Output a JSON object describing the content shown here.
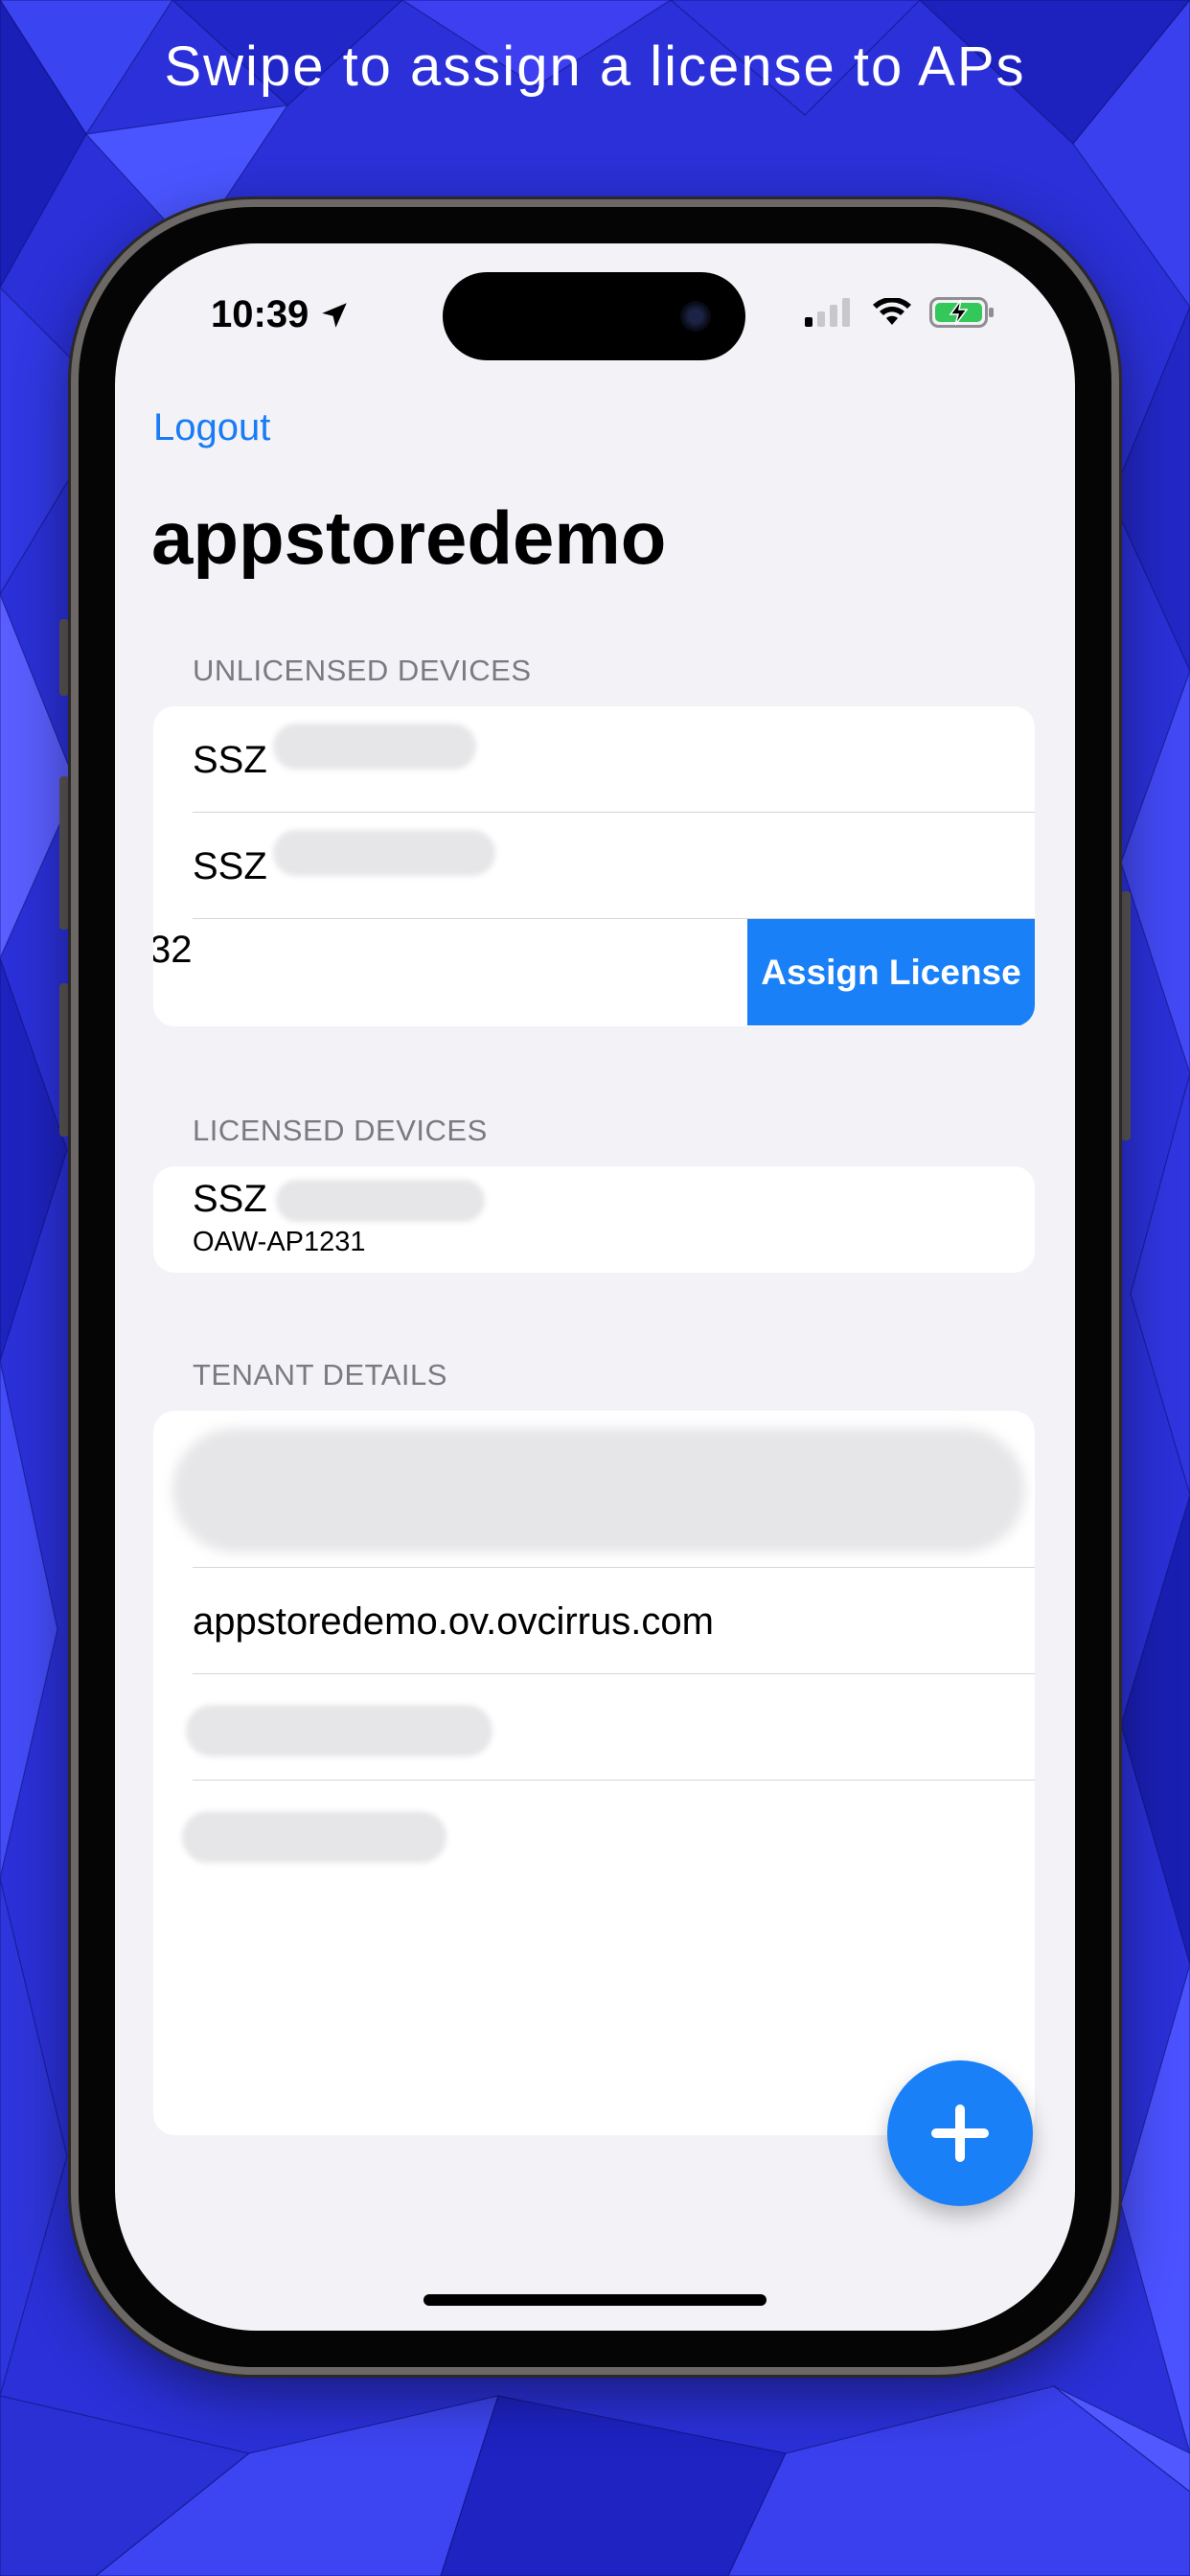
{
  "caption": "Swipe to assign a license to APs",
  "status_bar": {
    "time": "10:39",
    "location_icon": "location-arrow-icon",
    "signal_icon": "cellular-signal-icon",
    "wifi_icon": "wifi-icon",
    "battery_icon": "battery-charging-icon"
  },
  "nav": {
    "logout_label": "Logout"
  },
  "page_title": "appstoredemo",
  "unlicensed": {
    "header": "UNLICENSED DEVICES",
    "rows": [
      {
        "label": "SSZ"
      },
      {
        "label": "SSZ"
      },
      {
        "label": "32",
        "action_label": "Assign License"
      }
    ]
  },
  "licensed": {
    "header": "LICENSED DEVICES",
    "rows": [
      {
        "label": "SSZ",
        "subtitle": "OAW-AP1231"
      }
    ]
  },
  "tenant": {
    "header": "TENANT DETAILS",
    "rows": [
      {
        "label": ""
      },
      {
        "label": "appstoredemo.ov.ovcirrus.com"
      },
      {
        "label": ""
      },
      {
        "label": ""
      }
    ]
  },
  "fab": {
    "icon": "plus-icon"
  },
  "colors": {
    "accent": "#1a80f7",
    "background": "#f2f2f7",
    "backdrop": "#2a2fd6",
    "battery_charging": "#34c759"
  }
}
